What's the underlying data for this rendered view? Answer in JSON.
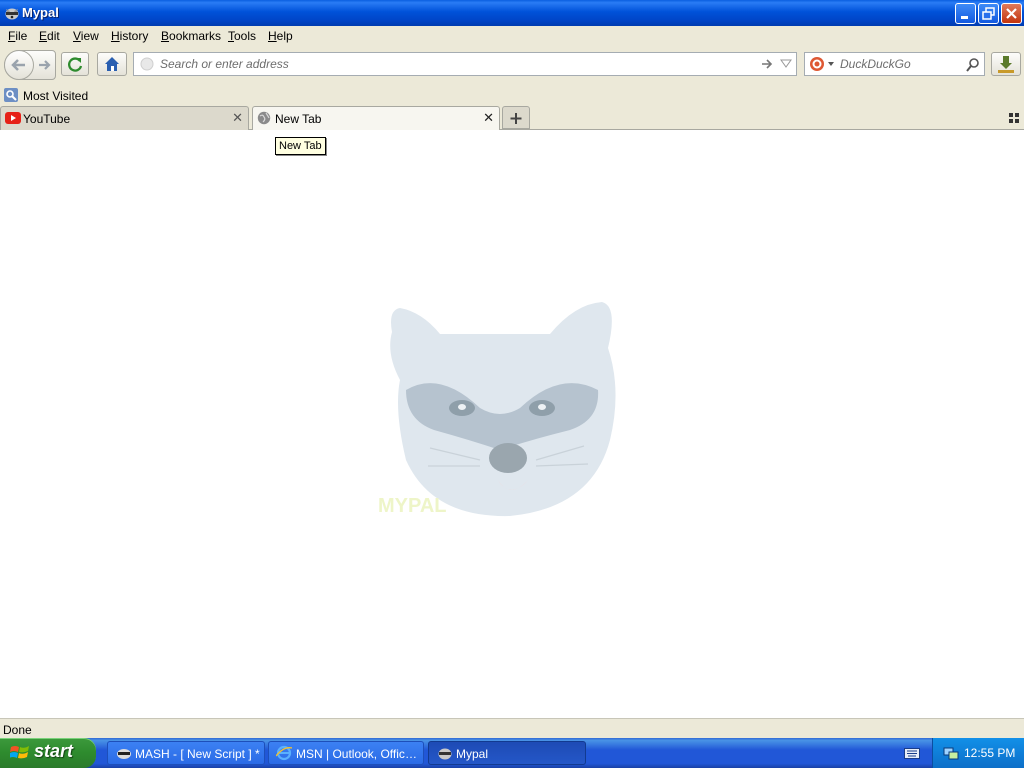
{
  "window": {
    "title": "Mypal"
  },
  "menu": [
    "File",
    "Edit",
    "View",
    "History",
    "Bookmarks",
    "Tools",
    "Help"
  ],
  "urlbar": {
    "placeholder": "Search or enter address"
  },
  "search": {
    "engine": "DuckDuckGo",
    "placeholder": "DuckDuckGo"
  },
  "bookmarks": {
    "most_visited": "Most Visited"
  },
  "tabs": [
    {
      "label": "YouTube",
      "icon": "youtube-icon"
    },
    {
      "label": "New Tab",
      "icon": "globe-icon",
      "active": true
    }
  ],
  "tooltip": "New Tab",
  "content": {
    "logo": "mypal-raccoon-logo",
    "logo_text": "MYPAL"
  },
  "status": "Done",
  "taskbar": {
    "start": "start",
    "items": [
      {
        "label": "MASH - [ New Script ] *",
        "icon": "mash-icon"
      },
      {
        "label": "MSN | Outlook, Office...",
        "icon": "ie-icon"
      },
      {
        "label": "Mypal",
        "icon": "mypal-icon",
        "active": true
      }
    ],
    "clock": "12:55 PM"
  },
  "colors": {
    "titlebar": "#0054e3",
    "chrome": "#ece9d8",
    "taskbar": "#2157d7",
    "start": "#2e8b2e",
    "tray": "#0f7fd9",
    "youtube": "#e62117"
  }
}
